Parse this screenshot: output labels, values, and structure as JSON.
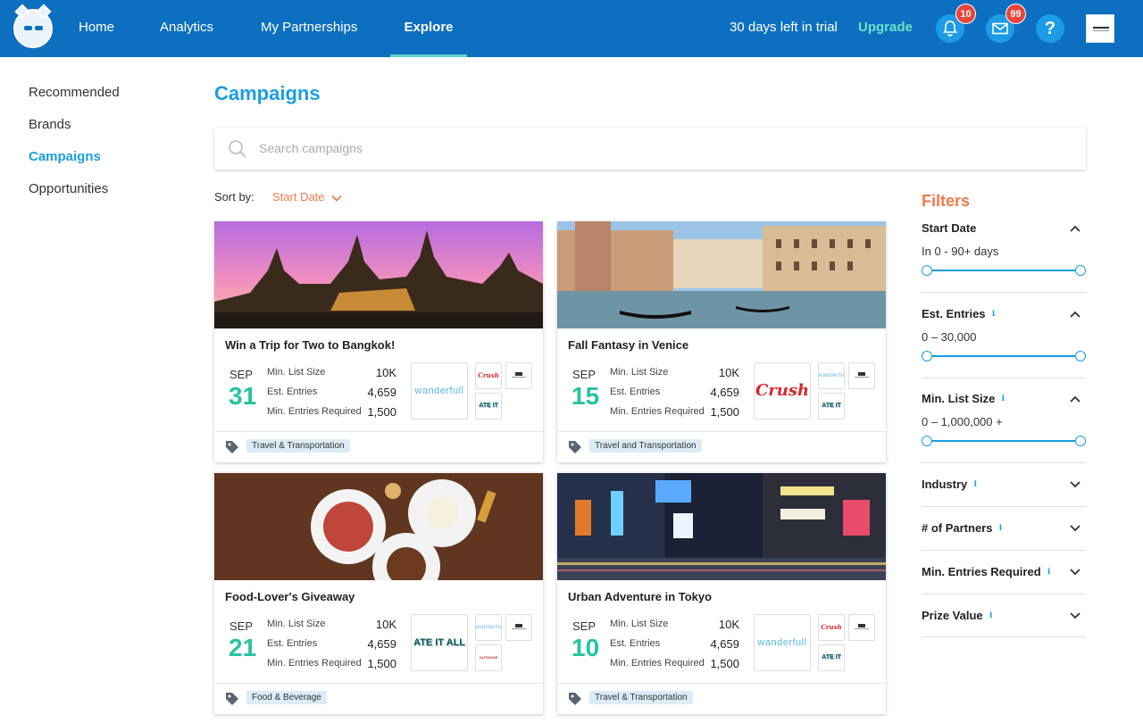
{
  "nav": {
    "home": "Home",
    "analytics": "Analytics",
    "partnerships": "My Partnerships",
    "explore": "Explore",
    "trial": "30 days left in trial",
    "upgrade": "Upgrade",
    "notif_count": "10",
    "mail_count": "99",
    "help": "?"
  },
  "sidebar": {
    "items": [
      "Recommended",
      "Brands",
      "Campaigns",
      "Opportunities"
    ]
  },
  "page": {
    "title": "Campaigns",
    "search_placeholder": "Search campaigns",
    "sort_label": "Sort by:",
    "sort_value": "Start Date"
  },
  "cards": [
    {
      "title": "Win a Trip for Two to Bangkok!",
      "month": "SEP",
      "day": "31",
      "min_list_label": "Min. List Size",
      "min_list": "10K",
      "est_entries_label": "Est. Entries",
      "est_entries": "4,659",
      "min_req_label": "Min. Entries Required",
      "min_req": "1,500",
      "tag": "Travel & Transportation",
      "brand_main": "wanderfull",
      "brand_a": "Crush",
      "brand_c": "ATE IT ALL"
    },
    {
      "title": "Fall Fantasy in Venice",
      "month": "SEP",
      "day": "15",
      "min_list_label": "Min. List Size",
      "min_list": "10K",
      "est_entries_label": "Est. Entries",
      "est_entries": "4,659",
      "min_req_label": "Min. Entries Required",
      "min_req": "1,500",
      "tag": "Travel and Transportation",
      "brand_main": "Crush",
      "brand_a": "wanderfull",
      "brand_c": "ATE IT ALL"
    },
    {
      "title": "Food-Lover's Giveaway",
      "month": "SEP",
      "day": "21",
      "min_list_label": "Min. List Size",
      "min_list": "10K",
      "est_entries_label": "Est. Entries",
      "est_entries": "4,659",
      "min_req_label": "Min. Entries Required",
      "min_req": "1,500",
      "tag": "Food & Beverage",
      "brand_main": "ATE IT ALL",
      "brand_a": "wanderfull",
      "brand_c": "OUTDOOR SPORTS"
    },
    {
      "title": "Urban Adventure in Tokyo",
      "month": "SEP",
      "day": "10",
      "min_list_label": "Min. List Size",
      "min_list": "10K",
      "est_entries_label": "Est. Entries",
      "est_entries": "4,659",
      "min_req_label": "Min. Entries Required",
      "min_req": "1,500",
      "tag": "Travel & Transportation",
      "brand_main": "wanderfull",
      "brand_a": "Crush",
      "brand_c": "ATE IT ALL"
    }
  ],
  "filters": {
    "title": "Filters",
    "start_date": {
      "label": "Start Date",
      "value": "In 0 - 90+ days"
    },
    "est_entries": {
      "label": "Est. Entries",
      "value": "0 – 30,000"
    },
    "min_list": {
      "label": "Min. List Size",
      "value": "0 – 1,000,000 +"
    },
    "industry": "Industry",
    "partners": "# of Partners",
    "min_entries": "Min. Entries Required",
    "prize": "Prize Value",
    "info": "i"
  },
  "colors": {
    "topbar": "#0d6fbf",
    "accent": "#1a9ee0",
    "orange": "#f07a4a",
    "green": "#27c4a0",
    "badge": "#e8453c"
  }
}
